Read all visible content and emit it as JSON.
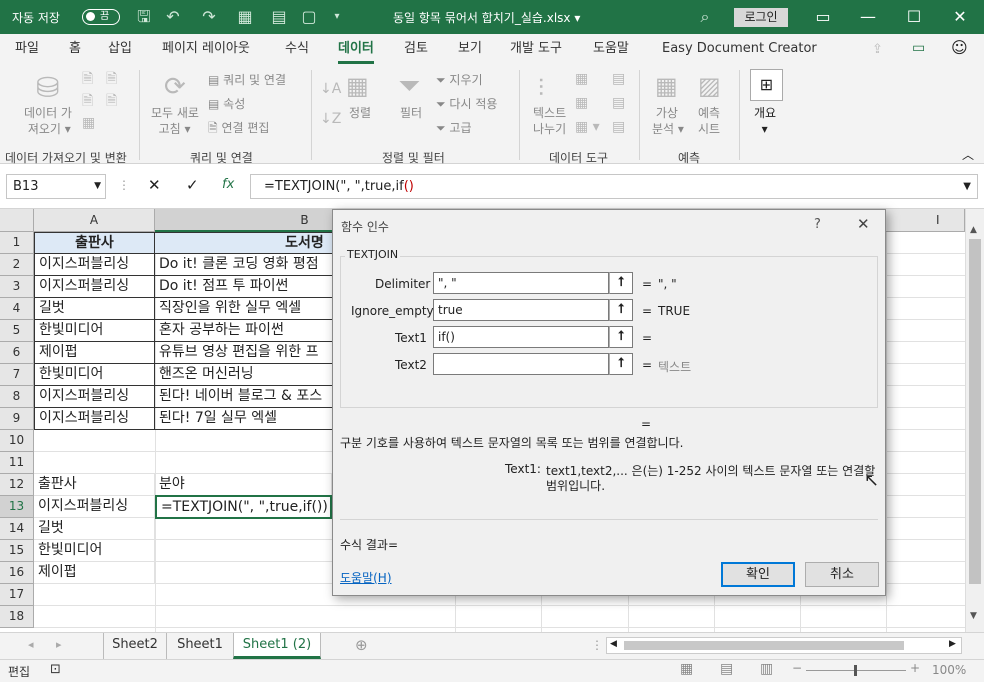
{
  "titlebar": {
    "autosave_label": "자동 저장",
    "autosave_state": "끔",
    "filename": "동일 항목 묶어서 합치기_실습.xlsx",
    "login": "로그인"
  },
  "tabs": [
    "파일",
    "홈",
    "삽입",
    "페이지 레이아웃",
    "수식",
    "데이터",
    "검토",
    "보기",
    "개발 도구",
    "도움말",
    "Easy Document Creator"
  ],
  "active_tab": "데이터",
  "ribbon": {
    "get_data": [
      "데이터 가",
      "져오기"
    ],
    "refresh_all": [
      "모두 새로",
      "고침"
    ],
    "queries_connections": "쿼리 및 연결",
    "properties": "속성",
    "edit_links": "연결 편집",
    "sort": "정렬",
    "filter": "필터",
    "clear": "지우기",
    "reapply": "다시 적용",
    "advanced": "고급",
    "text_to_columns": [
      "텍스트",
      "나누기"
    ],
    "what_if": [
      "가상",
      "분석"
    ],
    "forecast_sheet": [
      "예측",
      "시트"
    ],
    "outline": "개요",
    "groups": [
      "데이터 가져오기 및 변환",
      "쿼리 및 연결",
      "정렬 및 필터",
      "데이터 도구",
      "예측"
    ]
  },
  "formula_bar": {
    "name_box": "B13",
    "formula_prefix": "=TEXTJOIN(\", \",true,if",
    "formula_paren": "()",
    "fx": "fx"
  },
  "columns": [
    "A",
    "B",
    "I"
  ],
  "rows": [
    "1",
    "2",
    "3",
    "4",
    "5",
    "6",
    "7",
    "8",
    "9",
    "10",
    "11",
    "12",
    "13",
    "14",
    "15",
    "16",
    "17",
    "18"
  ],
  "table": {
    "header_a": "출판사",
    "header_b": "도서명",
    "col_a": [
      "이지스퍼블리싱",
      "이지스퍼블리싱",
      "길벗",
      "한빛미디어",
      "제이펍",
      "한빛미디어",
      "이지스퍼블리싱",
      "이지스퍼블리싱"
    ],
    "col_b": [
      "Do it! 클론 코딩 영화 평점",
      "Do it! 점프 투 파이썬",
      "직장인을 위한 실무 엑셀",
      "혼자 공부하는 파이썬",
      "유튜브 영상 편집을 위한 프",
      "핸즈온 머신러닝",
      "된다! 네이버 블로그 & 포스",
      "된다! 7일 실무 엑셀"
    ]
  },
  "summary": {
    "label_a": "출판사",
    "label_b": "분야",
    "col_a": [
      "이지스퍼블리싱",
      "길벗",
      "한빛미디어",
      "제이펍"
    ],
    "b13": "=TEXTJOIN(\", \",true,if())"
  },
  "sheets": [
    "Sheet2",
    "Sheet1",
    "Sheet1 (2)"
  ],
  "active_sheet": "Sheet1 (2)",
  "status": {
    "mode": "편집",
    "zoom": "100%"
  },
  "dialog": {
    "title": "함수 인수",
    "help_q": "?",
    "function_name": "TEXTJOIN",
    "args": [
      {
        "label": "Delimiter",
        "value": "\", \"",
        "result": "\", \""
      },
      {
        "label": "Ignore_empty",
        "value": "true",
        "result": "TRUE"
      },
      {
        "label": "Text1",
        "value": "if()",
        "result": ""
      },
      {
        "label": "Text2",
        "value": "",
        "result": "텍스트"
      }
    ],
    "eq": "=",
    "description": "구분 기호를 사용하여 텍스트 문자열의 목록 또는 범위를 연결합니다.",
    "arg_help_name": "Text1:",
    "arg_help_line1": "text1,text2,... 은(는) 1-252 사이의 텍스트 문자열 또는 연결할",
    "arg_help_line2": "범위입니다.",
    "formula_result": "수식 결과=",
    "help_link": "도움말(H)",
    "ok": "확인",
    "cancel": "취소"
  }
}
